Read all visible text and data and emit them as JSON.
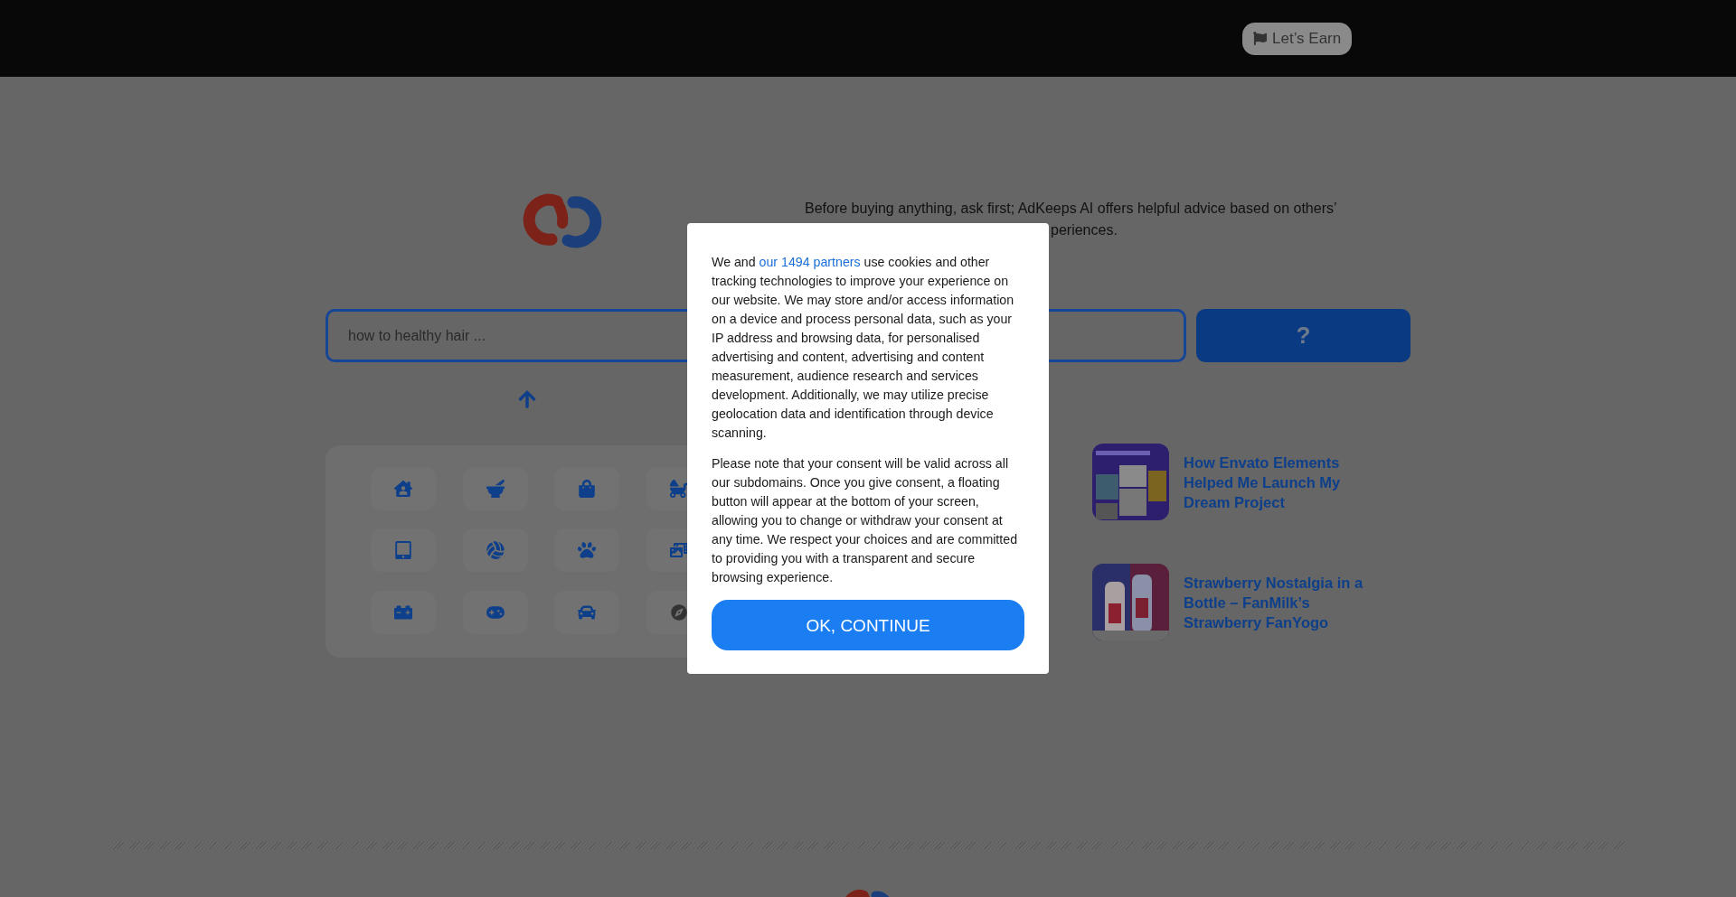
{
  "header": {
    "earn_button": "Let’s Earn"
  },
  "tagline": {
    "line_1": "Before buying anything, ask first; AdKeeps AI offers helpful advice based on others’",
    "line_2_visible": "periences."
  },
  "search": {
    "placeholder": "how to healthy hair ...",
    "button": "?"
  },
  "articles": [
    {
      "title": "How Envato Elements Helped Me Launch My Dream Project"
    },
    {
      "title": "Strawberry Nostalgia in a Bottle – FanMilk’s Strawberry FanYogo"
    }
  ],
  "consent": {
    "paragraph_1": {
      "before": "We and ",
      "link": "our 1494 partners",
      "after": " use cookies and other tracking technologies to improve your experience on our website. We may store and/or access information on a device and process personal data, such as your IP address and browsing data, for personalised advertising and content, advertising and content measurement, audience research and services development. Additionally, we may utilize precise geolocation data and identification through device scanning."
    },
    "paragraph_2": "Please note that your consent will be valid across all our subdomains. Once you give consent, a floating button will appear at the bottom of your screen, allowing you to change or withdraw your consent at any time. We respect your choices and are committed to providing you with a transparent and secure browsing experience.",
    "button": "OK, CONTINUE"
  }
}
